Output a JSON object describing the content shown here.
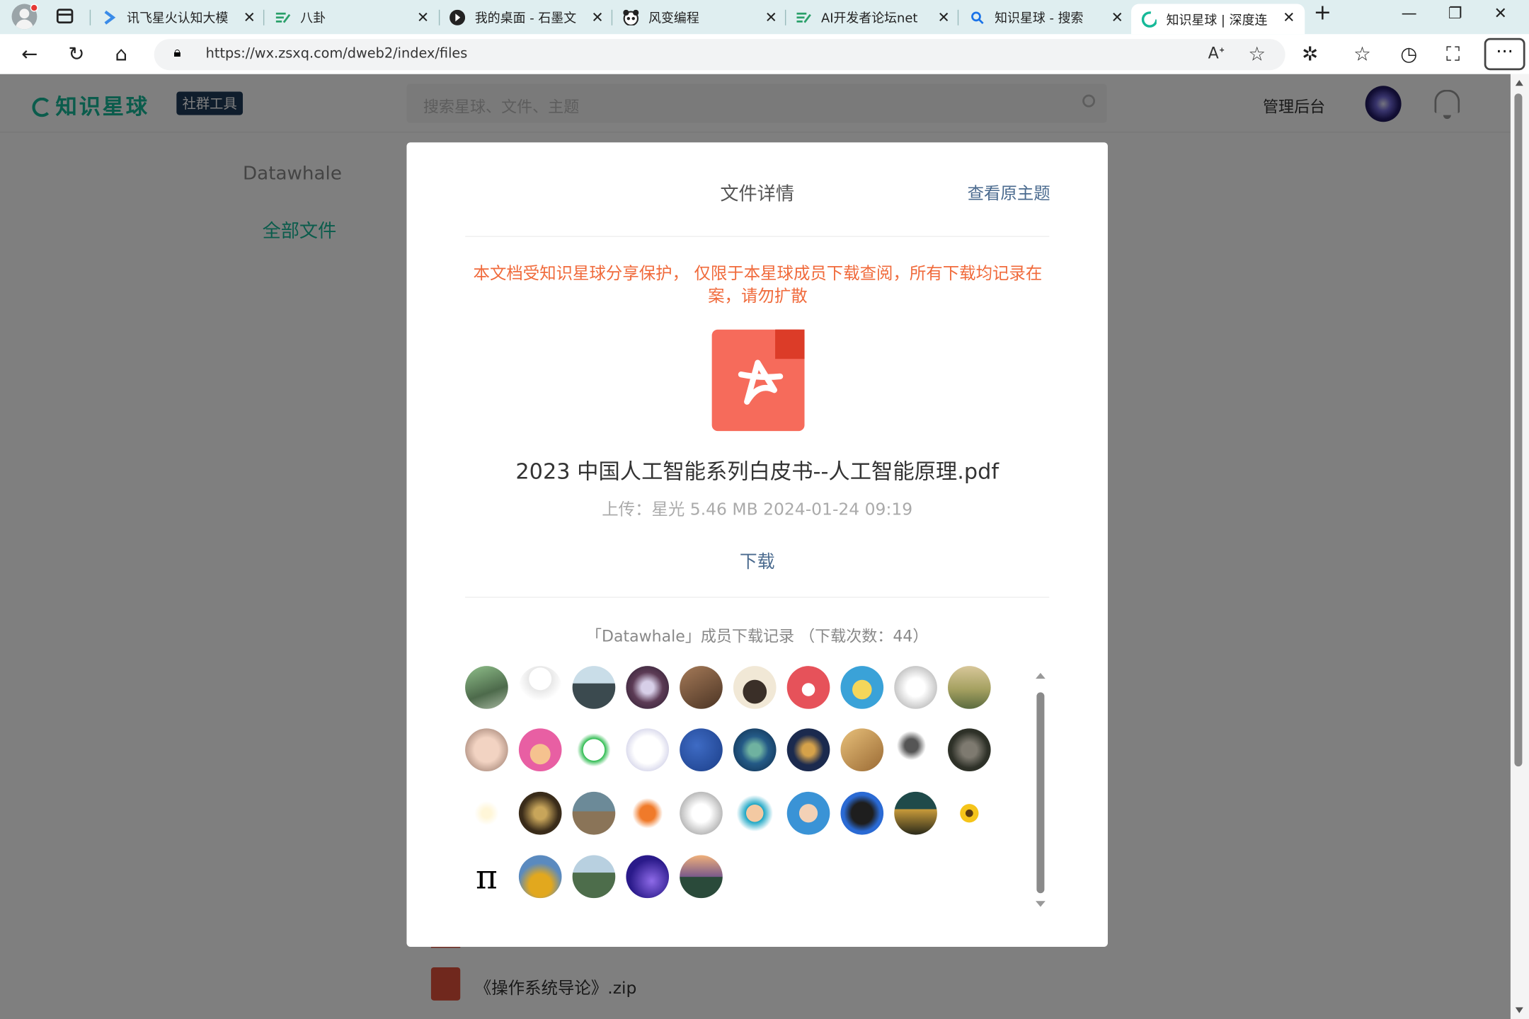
{
  "browser": {
    "tabs": [
      {
        "title": "讯飞星火认知大模",
        "icon": "spark-icon"
      },
      {
        "title": "八卦",
        "icon": "pencil-icon"
      },
      {
        "title": "我的桌面 - 石墨文",
        "icon": "shimo-icon"
      },
      {
        "title": "风变编程",
        "icon": "panda-icon"
      },
      {
        "title": "AI开发者论坛net",
        "icon": "pencil-icon"
      },
      {
        "title": "知识星球 - 搜索",
        "icon": "search-icon"
      },
      {
        "title": "知识星球 | 深度连",
        "icon": "loading-icon"
      }
    ],
    "url": "https://wx.zsxq.com/dweb2/index/files",
    "accent": "#dfeef0"
  },
  "header": {
    "logo": "知识星球",
    "tag": "社群工具",
    "search_placeholder": "搜索星球、文件、主题",
    "admin": "管理后台"
  },
  "sidebar": {
    "group": "Datawhale",
    "item": "全部文件"
  },
  "list": {
    "item_name": "《操作系统导论》.zip"
  },
  "modal": {
    "title": "文件详情",
    "view_topic": "查看原主题",
    "notice": "本文档受知识星球分享保护， 仅限于本星球成员下载查阅，所有下载均记录在案，请勿扩散",
    "file_name": "2023 中国人工智能系列白皮书--人工智能原理.pdf",
    "meta": "上传：星光   5.46 MB   2024-01-24 09:19",
    "download": "下载",
    "record": "「Datawhale」成员下载记录 （下载次数：44）"
  },
  "colors": {
    "brand": "#16b998",
    "warning": "#f06a3b",
    "link": "#4a6a8e",
    "pdf": "#f66b5b"
  }
}
